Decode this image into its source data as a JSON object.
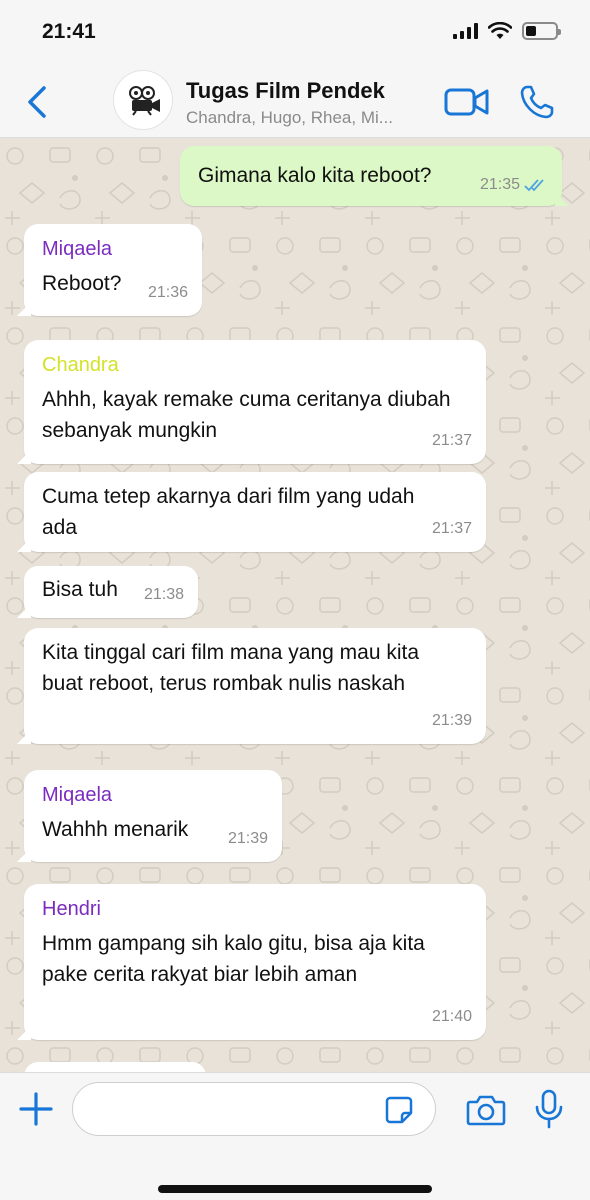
{
  "status_bar": {
    "time": "21:41",
    "battery_level": 0.35
  },
  "header": {
    "title": "Tugas Film Pendek",
    "subtitle": "Chandra, Hugo, Rhea, Mi...",
    "accent_color": "#1877d6"
  },
  "messages": [
    {
      "direction": "outgoing",
      "sender": "",
      "text": "Gimana kalo kita reboot?",
      "time": "21:35",
      "read": true
    },
    {
      "direction": "incoming",
      "sender": "Miqaela",
      "sender_color": "#7b2cbf",
      "text": "Reboot?",
      "time": "21:36"
    },
    {
      "direction": "incoming",
      "sender": "Chandra",
      "sender_color": "#d4e22a",
      "text": "Ahhh, kayak remake cuma ceritanya diubah sebanyak mungkin",
      "time": "21:37"
    },
    {
      "direction": "incoming",
      "sender": "",
      "text": "Cuma tetep akarnya dari film yang udah ada",
      "time": "21:37"
    },
    {
      "direction": "incoming",
      "sender": "",
      "text": "Bisa tuh",
      "time": "21:38"
    },
    {
      "direction": "incoming",
      "sender": "",
      "text": "Kita tinggal cari film mana yang mau kita buat reboot, terus rombak nulis naskah",
      "time": "21:39"
    },
    {
      "direction": "incoming",
      "sender": "Miqaela",
      "sender_color": "#7b2cbf",
      "text": "Wahhh menarik",
      "time": "21:39"
    },
    {
      "direction": "incoming",
      "sender": "Hendri",
      "sender_color": "#7b2cbf",
      "text": "Hmm gampang sih kalo gitu, bisa aja kita pake cerita rakyat biar lebih aman",
      "time": "21:40"
    }
  ],
  "composer": {
    "input_value": "",
    "placeholder": ""
  },
  "icons": {
    "back": "chevron-left-icon",
    "avatar": "film-camera-icon",
    "video": "video-call-icon",
    "call": "phone-icon",
    "plus": "plus-icon",
    "sticker": "sticker-icon",
    "camera": "camera-icon",
    "mic": "microphone-icon",
    "read_receipt": "double-check-icon"
  }
}
